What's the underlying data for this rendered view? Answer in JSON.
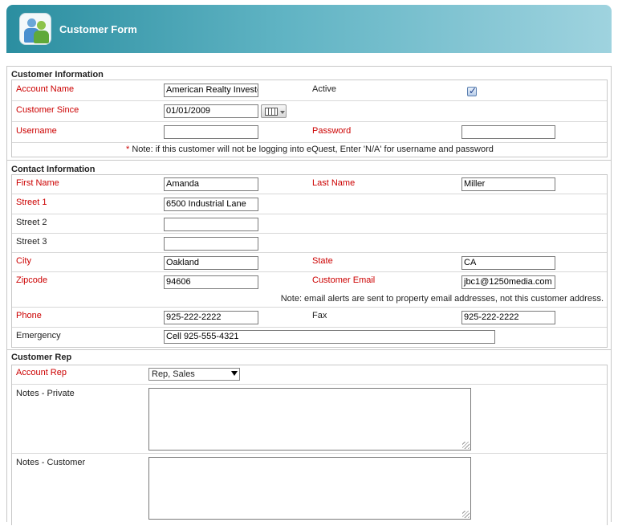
{
  "header": {
    "title": "Customer Form"
  },
  "customer_information": {
    "title": "Customer Information",
    "account_name": {
      "label": "Account Name",
      "value": "American Realty Investors"
    },
    "active": {
      "label": "Active",
      "checked": true
    },
    "customer_since": {
      "label": "Customer Since",
      "value": "01/01/2009"
    },
    "username": {
      "label": "Username",
      "value": ""
    },
    "password": {
      "label": "Password",
      "value": ""
    },
    "note_marker": "*",
    "note": "Note: if this customer will not be logging into eQuest, Enter 'N/A' for username and password"
  },
  "contact_information": {
    "title": "Contact Information",
    "first_name": {
      "label": "First Name",
      "value": "Amanda"
    },
    "last_name": {
      "label": "Last Name",
      "value": "Miller"
    },
    "street1": {
      "label": "Street 1",
      "value": "6500 Industrial Lane"
    },
    "street2": {
      "label": "Street 2",
      "value": ""
    },
    "street3": {
      "label": "Street 3",
      "value": ""
    },
    "city": {
      "label": "City",
      "value": "Oakland"
    },
    "state": {
      "label": "State",
      "value": "CA"
    },
    "zipcode": {
      "label": "Zipcode",
      "value": "94606"
    },
    "customer_email": {
      "label": "Customer Email",
      "value": "jbc1@1250media.com"
    },
    "email_note": "Note: email alerts are sent to property email addresses, not this customer address.",
    "phone": {
      "label": "Phone",
      "value": "925-222-2222"
    },
    "fax": {
      "label": "Fax",
      "value": "925-222-2222"
    },
    "emergency": {
      "label": "Emergency",
      "value": "Cell 925-555-4321"
    }
  },
  "customer_rep": {
    "title": "Customer Rep",
    "account_rep": {
      "label": "Account Rep",
      "value": "Rep, Sales"
    },
    "notes_private": {
      "label": "Notes - Private",
      "value": ""
    },
    "notes_customer": {
      "label": "Notes - Customer",
      "value": ""
    }
  },
  "colors": {
    "required_label": "#cc0000",
    "header_start": "#2b8ea0",
    "header_end": "#9fd3df"
  }
}
